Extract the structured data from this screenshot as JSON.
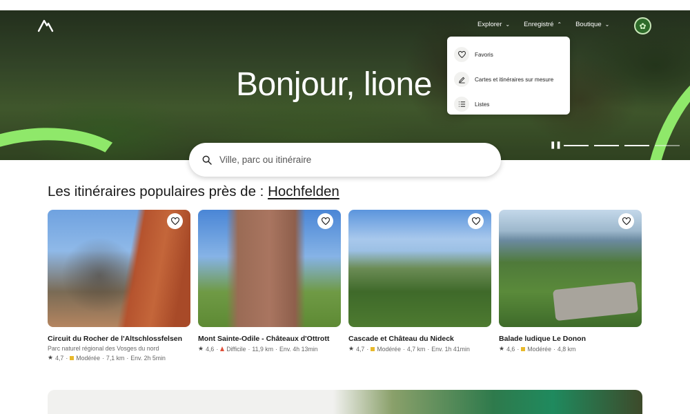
{
  "header": {
    "nav": [
      {
        "label": "Explorer"
      },
      {
        "label": "Enregistré"
      },
      {
        "label": "Boutique"
      }
    ]
  },
  "hero": {
    "greeting": "Bonjour, lione"
  },
  "saved_menu": {
    "items": [
      {
        "label": "Favoris",
        "icon": "heart-icon"
      },
      {
        "label": "Cartes et itinéraires sur mesure",
        "icon": "pen-icon"
      },
      {
        "label": "Listes",
        "icon": "list-icon"
      }
    ]
  },
  "search": {
    "placeholder": "Ville, parc ou itinéraire"
  },
  "section": {
    "title_prefix": "Les itinéraires populaires près de :",
    "location": "Hochfelden"
  },
  "cards": [
    {
      "title": "Circuit du Rocher de l'Altschlossfelsen",
      "subtitle": "Parc naturel régional des Vosges du nord",
      "rating": "4,7",
      "difficulty": "Modérée",
      "difficulty_color": "#e8b92c",
      "distance": "7,1 km",
      "duration": "Env. 2h 5min"
    },
    {
      "title": "Mont Sainte-Odile - Châteaux d'Ottrott",
      "subtitle": "",
      "rating": "4,6",
      "difficulty": "Difficile",
      "difficulty_color": "#e0503a",
      "distance": "11,9 km",
      "duration": "Env. 4h 13min"
    },
    {
      "title": "Cascade et Château du Nideck",
      "subtitle": "",
      "rating": "4,7",
      "difficulty": "Modérée",
      "difficulty_color": "#e8b92c",
      "distance": "4,7 km",
      "duration": "Env. 1h 41min"
    },
    {
      "title": "Balade ludique Le Donon",
      "subtitle": "",
      "rating": "4,6",
      "difficulty": "Modérée",
      "difficulty_color": "#e8b92c",
      "distance": "4,8 km",
      "duration": ""
    }
  ],
  "colors": {
    "accent_green": "#8fe86a"
  }
}
